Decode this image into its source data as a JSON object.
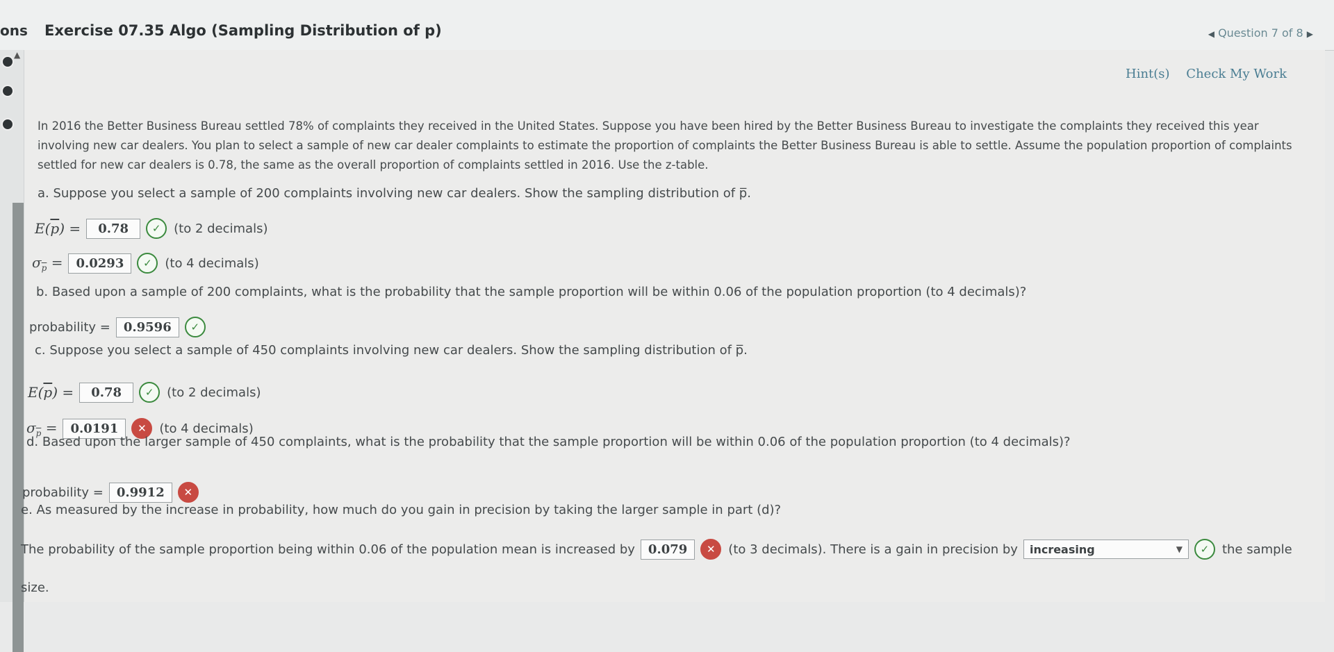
{
  "header": {
    "nav_fragment": "ons",
    "title": "Exercise 07.35 Algo (Sampling Distribution of p)",
    "question_nav": "Question 7 of 8"
  },
  "links": {
    "hint": "Hint(s)",
    "check": "Check My Work"
  },
  "intro": "In 2016 the Better Business Bureau settled 78% of complaints they received in the United States. Suppose you have been hired by the Better Business Bureau to investigate the complaints they received this year involving new car dealers. You plan to select a sample of new car dealer complaints to estimate the proportion of complaints the Better Business Bureau is able to settle. Assume the population proportion of complaints settled for new car dealers is 0.78, the same as the overall proportion of complaints settled in 2016. Use the z-table.",
  "part_a": {
    "question": "a. Suppose you select a sample of 200 complaints involving new car dealers. Show the sampling distribution of p̅.",
    "expected_value": "0.78",
    "expected_note": "(to 2 decimals)",
    "sigma_value": "0.0293",
    "sigma_note": "(to 4 decimals)"
  },
  "part_b": {
    "question": "b. Based upon a sample of 200 complaints, what is the probability that the sample proportion will be within 0.06 of the population proportion (to 4 decimals)?",
    "label": "probability =",
    "value": "0.9596"
  },
  "part_c": {
    "question": "c. Suppose you select a sample of 450 complaints involving new car dealers. Show the sampling distribution of p̅.",
    "expected_value": "0.78",
    "expected_note": "(to 2 decimals)",
    "sigma_value": "0.0191",
    "sigma_note": "(to 4 decimals)"
  },
  "part_d": {
    "question": "d. Based upon the larger sample of 450 complaints, what is the probability that the sample proportion will be within 0.06 of the population proportion (to 4 decimals)?",
    "label": "probability =",
    "value": "0.9912"
  },
  "part_e": {
    "question": "e. As measured by the increase in probability, how much do you gain in precision by taking the larger sample in part (d)?",
    "prefix": "The probability of the sample proportion being within 0.06 of the population mean is increased by",
    "value": "0.079",
    "middle": "(to 3 decimals). There is a gain in precision by",
    "select_value": "increasing",
    "suffix": "the sample",
    "tail": "size."
  },
  "icons": {
    "correct": "check-circle-icon",
    "incorrect": "x-circle-icon"
  },
  "colors": {
    "correct": "#3b8a3e",
    "incorrect": "#c84a42",
    "link": "#4a7d92"
  }
}
